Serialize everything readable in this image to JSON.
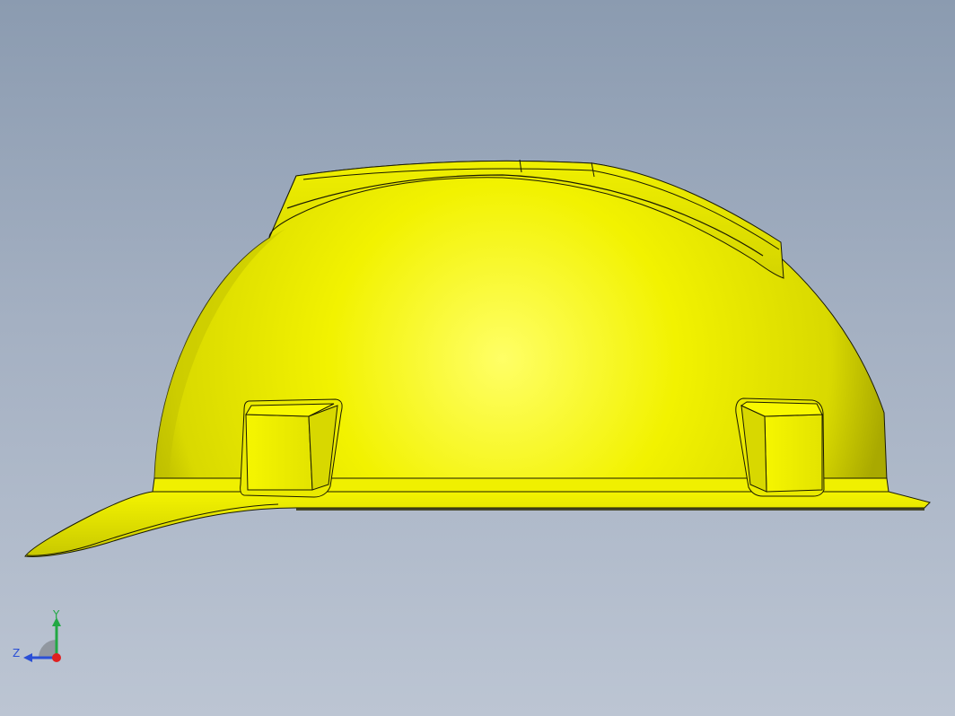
{
  "viewport": {
    "background_top": "#8b9bb0",
    "background_bottom": "#bcc5d3"
  },
  "model": {
    "icon": "hard-hat-model",
    "base_color": "#f0f000",
    "highlight_color": "#ffff66",
    "shade_color": "#9a9a00",
    "edge_color": "#1a1a00"
  },
  "triad": {
    "y_label": "Y",
    "z_label": "Z",
    "y_color": "#22a844",
    "z_color": "#2a4fd6",
    "x_color": "#e02020"
  }
}
